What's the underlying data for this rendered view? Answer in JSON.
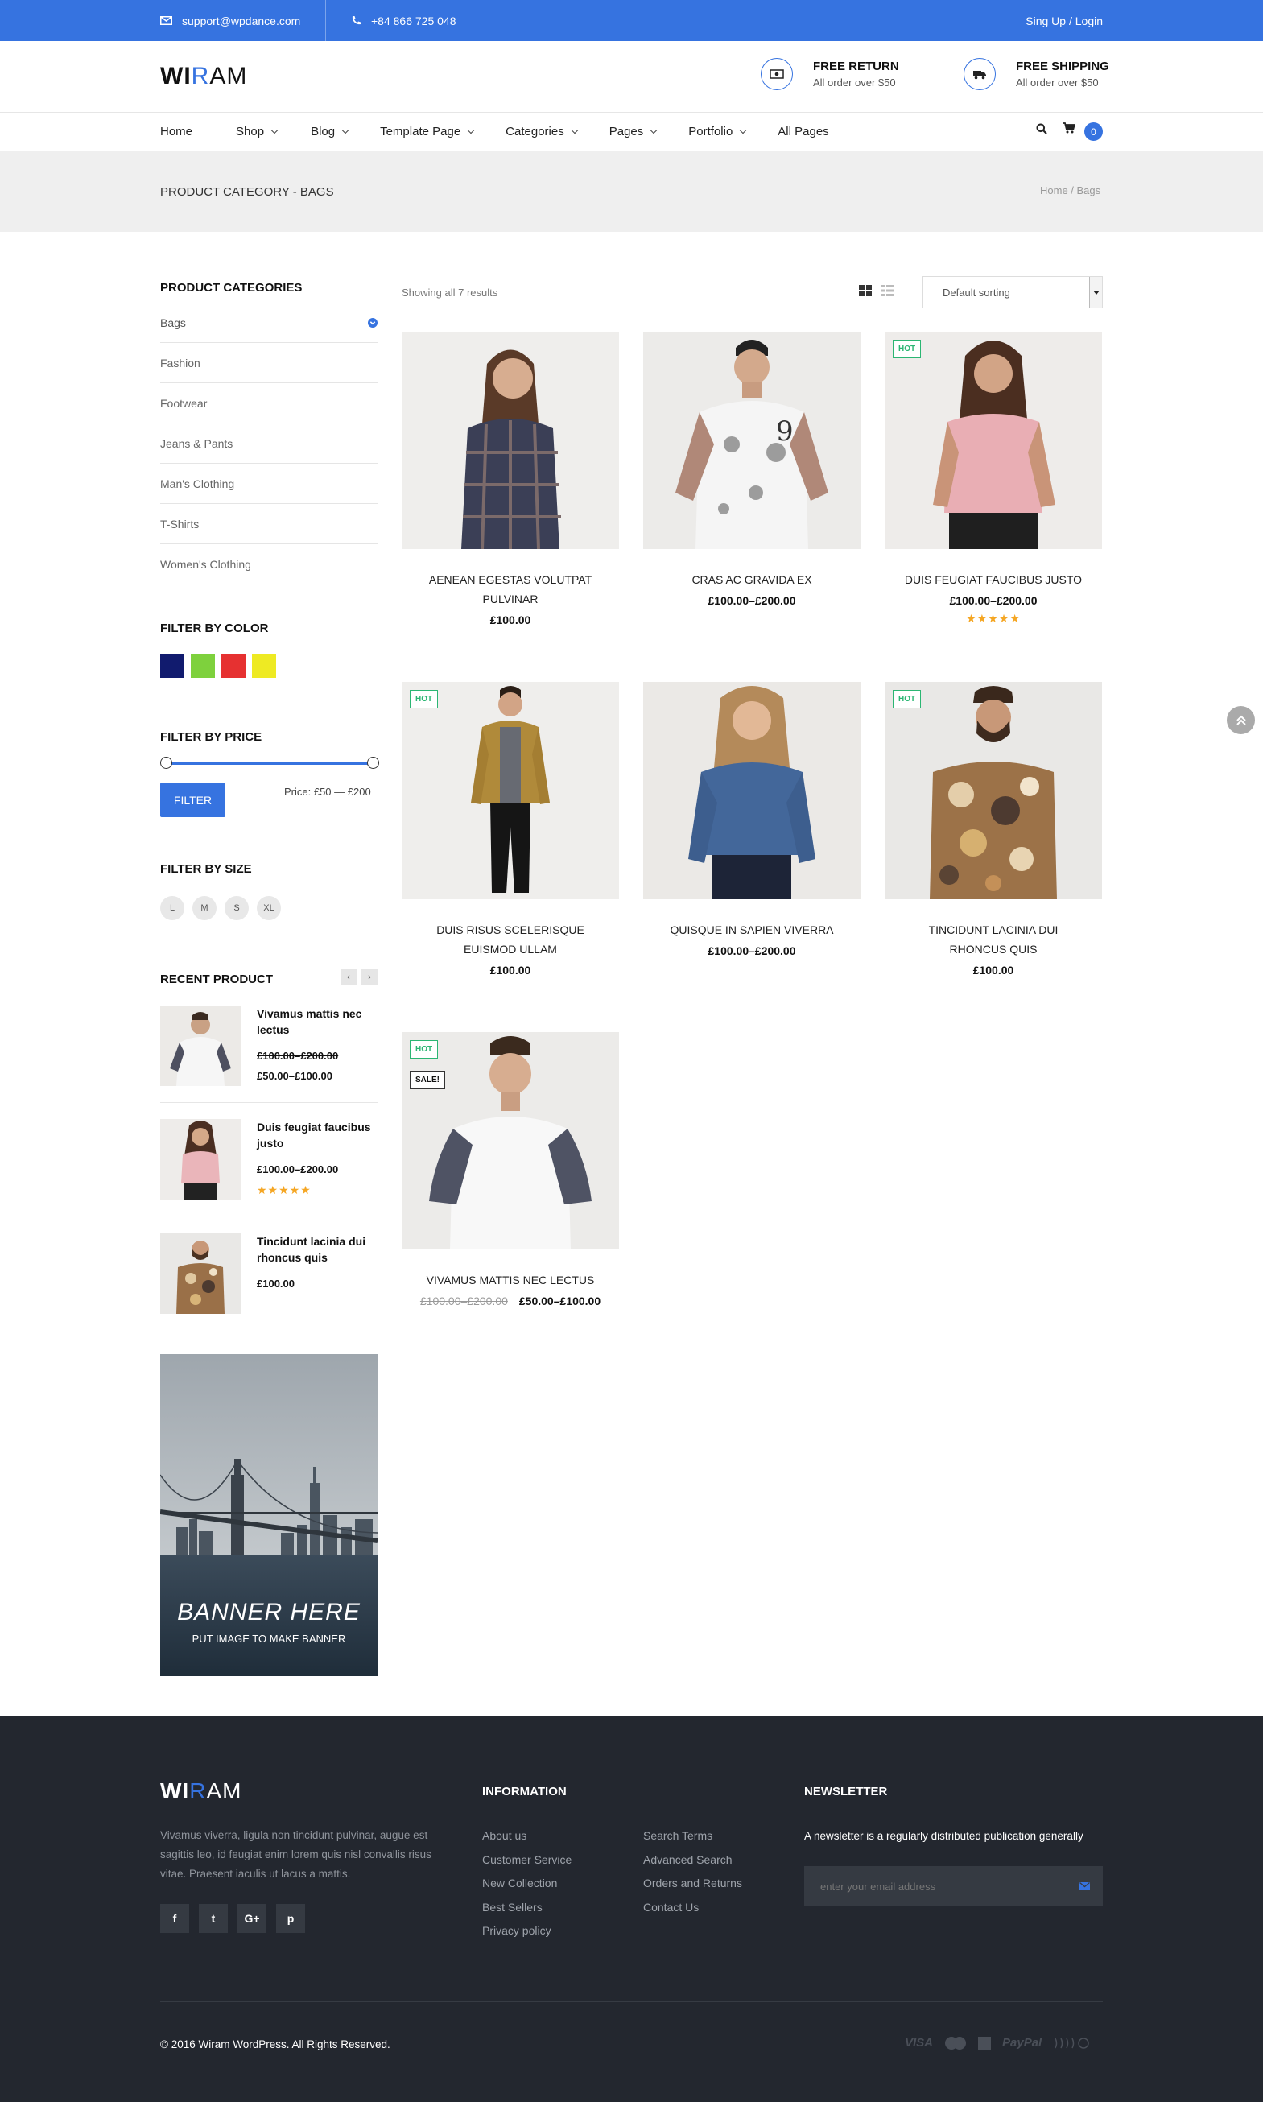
{
  "topbar": {
    "email": "support@wpdance.com",
    "phone": "+84 866 725 048",
    "signup": "Sing Up / Login"
  },
  "header": {
    "logo_bold": "WI",
    "logo_accent": "R",
    "logo_thin": "AM",
    "features": [
      {
        "title": "FREE RETURN",
        "subtitle": "All order over $50",
        "icon": "money-icon"
      },
      {
        "title": "FREE SHIPPING",
        "subtitle": "All order over $50",
        "icon": "truck-icon"
      }
    ],
    "cart_count": "0"
  },
  "nav": {
    "items": [
      {
        "label": "Home",
        "dropdown": false
      },
      {
        "label": "Shop",
        "dropdown": true
      },
      {
        "label": "Blog",
        "dropdown": true
      },
      {
        "label": "Template Page",
        "dropdown": true
      },
      {
        "label": "Categories",
        "dropdown": true
      },
      {
        "label": "Pages",
        "dropdown": true
      },
      {
        "label": "Portfolio",
        "dropdown": true
      },
      {
        "label": "All Pages",
        "dropdown": false
      }
    ]
  },
  "page": {
    "title": "PRODUCT CATEGORY - BAGS",
    "breadcrumb": "Home / Bags"
  },
  "sidebar": {
    "categories_title": "PRODUCT CATEGORIES",
    "categories": [
      "Bags",
      "Fashion",
      "Footwear",
      "Jeans & Pants",
      "Man's Clothing",
      "T-Shirts",
      "Women's Clothing"
    ],
    "color_title": "FILTER BY COLOR",
    "colors": [
      "#111b6e",
      "#7ed13d",
      "#e63131",
      "#eeea23"
    ],
    "price_title": "FILTER BY PRICE",
    "filter_button": "FILTER",
    "price_range": "Price: £50 — £200",
    "size_title": "FILTER BY SIZE",
    "sizes": [
      "L",
      "M",
      "S",
      "XL"
    ],
    "recent_title": "RECENT PRODUCT",
    "recent": [
      {
        "name": "Vivamus mattis nec lectus",
        "old_price": "£100.00–£200.00",
        "price": "£50.00–£100.00"
      },
      {
        "name": "Duis feugiat faucibus justo",
        "price": "£100.00–£200.00",
        "rating": "★★★★★"
      },
      {
        "name": "Tincidunt lacinia dui rhoncus quis",
        "price": "£100.00"
      }
    ],
    "banner_title": "BANNER HERE",
    "banner_sub": "PUT IMAGE TO MAKE BANNER"
  },
  "shop": {
    "results": "Showing all 7 results",
    "sorting": "Default sorting",
    "hot_label": "HOT",
    "sale_label": "SALE!",
    "products": [
      {
        "name": "AENEAN EGESTAS VOLUTPAT PULVINAR",
        "price": "£100.00"
      },
      {
        "name": "CRAS AC GRAVIDA EX",
        "price": "£100.00–£200.00"
      },
      {
        "name": "DUIS FEUGIAT FAUCIBUS JUSTO",
        "price": "£100.00–£200.00",
        "rating": "★★★★★"
      },
      {
        "name": "DUIS RISUS SCELERISQUE EUISMOD ULLAM",
        "price": "£100.00"
      },
      {
        "name": "QUISQUE IN SAPIEN VIVERRA",
        "price": "£100.00–£200.00"
      },
      {
        "name": "TINCIDUNT LACINIA DUI RHONCUS QUIS",
        "price": "£100.00"
      },
      {
        "name": "VIVAMUS MATTIS NEC LECTUS",
        "old_price": "£100.00–£200.00",
        "price": "£50.00–£100.00"
      }
    ]
  },
  "footer": {
    "about": "Vivamus viverra, ligula non tincidunt pulvinar, augue est sagittis leo, id feugiat enim lorem quis nisl convallis risus vitae. Praesent iaculis ut lacus a mattis.",
    "social": [
      "f",
      "t",
      "G+",
      "p"
    ],
    "info_title": "INFORMATION",
    "links_col1": [
      "About us",
      "Customer Service",
      "New Collection",
      "Best Sellers",
      "Privacy policy"
    ],
    "links_col2": [
      "Search Terms",
      "Advanced Search",
      "Orders and Returns",
      "Contact Us"
    ],
    "newsletter_title": "NEWSLETTER",
    "newsletter_text": "A newsletter is a regularly distributed publication generally",
    "email_placeholder": "enter your email address",
    "copyright": "© 2016 Wiram WordPress. All Rights Reserved.",
    "payments": [
      "VISA",
      "PayPal"
    ]
  }
}
